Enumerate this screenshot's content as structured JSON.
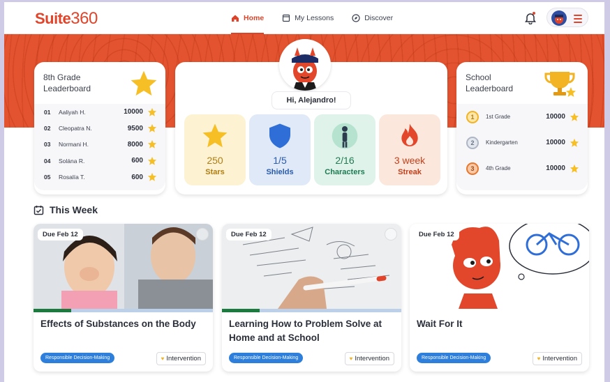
{
  "brand": {
    "logo_text": "Suite",
    "logo_num": "360",
    "accent": "#e0452b"
  },
  "nav": {
    "items": [
      {
        "label": "Home",
        "icon": "home-icon",
        "active": true
      },
      {
        "label": "My Lessons",
        "icon": "book-icon",
        "active": false
      },
      {
        "label": "Discover",
        "icon": "compass-icon",
        "active": false
      }
    ]
  },
  "leaderboard": {
    "title": "8th Grade Leaderboard",
    "rows": [
      {
        "rank": "01",
        "name": "Aaliyah H.",
        "score": "10000"
      },
      {
        "rank": "02",
        "name": "Cleopatra N.",
        "score": "9500"
      },
      {
        "rank": "03",
        "name": "Normani H.",
        "score": "8000"
      },
      {
        "rank": "04",
        "name": "Solána R.",
        "score": "600"
      },
      {
        "rank": "05",
        "name": "Rosalía T.",
        "score": "600"
      }
    ]
  },
  "school_leaderboard": {
    "title": "School Leaderboard",
    "rows": [
      {
        "rank": "1",
        "name": "1st Grade",
        "score": "10000",
        "color": "#f2b324"
      },
      {
        "rank": "2",
        "name": "Kindergarten",
        "score": "10000",
        "color": "#aeb6c4"
      },
      {
        "rank": "3",
        "name": "4th Grade",
        "score": "10000",
        "color": "#e8772e"
      }
    ]
  },
  "greeting": "Hi, Alejandro!",
  "stats": [
    {
      "value": "250",
      "label": "Stars",
      "bg": "#fdf3d3",
      "color": "#b07d12",
      "icon": "star-icon"
    },
    {
      "value": "1/5",
      "label": "Shields",
      "bg": "#dfe9f8",
      "color": "#2a5aa8",
      "icon": "shield-icon"
    },
    {
      "value": "2/16",
      "label": "Characters",
      "bg": "#dff3ea",
      "color": "#1f7a52",
      "icon": "character-icon"
    },
    {
      "value": "3 week",
      "label": "Streak",
      "bg": "#fbe7dc",
      "color": "#c2411c",
      "icon": "flame-icon"
    }
  ],
  "this_week": {
    "title": "This Week",
    "lessons": [
      {
        "due": "Due Feb 12",
        "title": "Effects of Substances on the Body",
        "tag": "Responsible Decision-Making",
        "badge": "Intervention",
        "progress": 0.21
      },
      {
        "due": "Due Feb 12",
        "title": "Learning How to Problem Solve at Home and at School",
        "tag": "Responsible Decision-Making",
        "badge": "Intervention",
        "progress": 0.21
      },
      {
        "due": "Due Feb 12",
        "title": "Wait For It",
        "tag": "Responsible Decision-Making",
        "badge": "Intervention",
        "progress": 0
      }
    ]
  }
}
